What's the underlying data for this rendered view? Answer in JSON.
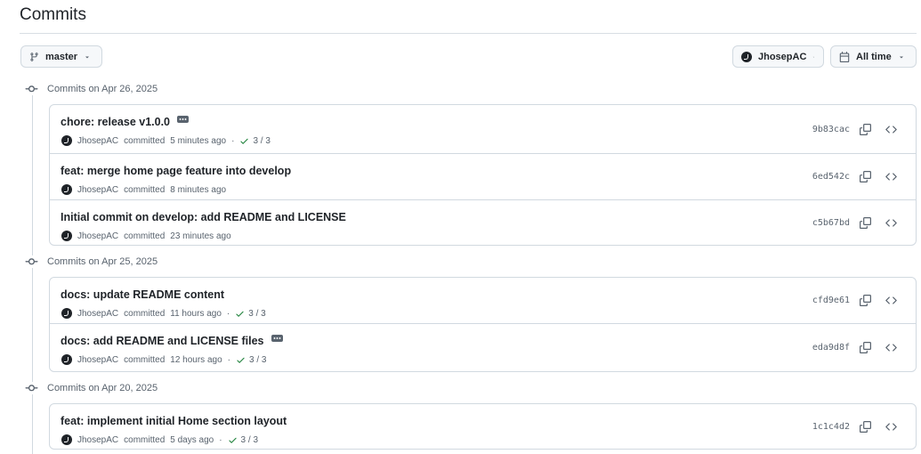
{
  "page": {
    "title": "Commits"
  },
  "toolbar": {
    "branch_label": "master",
    "user_label": "JhosepAC",
    "time_label": "All time"
  },
  "groups": [
    {
      "header": "Commits on Apr 26, 2025",
      "commits": [
        {
          "title": "chore: release v1.0.0",
          "has_ellipsis": true,
          "author": "JhosepAC",
          "action": "committed",
          "time": "5 minutes ago",
          "checks": "3 / 3",
          "sha": "9b83cac"
        },
        {
          "title": "feat: merge home page feature into develop",
          "has_ellipsis": false,
          "author": "JhosepAC",
          "action": "committed",
          "time": "8 minutes ago",
          "checks": "",
          "sha": "6ed542c"
        },
        {
          "title": "Initial commit on develop: add README and LICENSE",
          "has_ellipsis": false,
          "author": "JhosepAC",
          "action": "committed",
          "time": "23 minutes ago",
          "checks": "",
          "sha": "c5b67bd"
        }
      ]
    },
    {
      "header": "Commits on Apr 25, 2025",
      "commits": [
        {
          "title": "docs: update README content",
          "has_ellipsis": false,
          "author": "JhosepAC",
          "action": "committed",
          "time": "11 hours ago",
          "checks": "3 / 3",
          "sha": "cfd9e61"
        },
        {
          "title": "docs: add README and LICENSE files",
          "has_ellipsis": true,
          "author": "JhosepAC",
          "action": "committed",
          "time": "12 hours ago",
          "checks": "3 / 3",
          "sha": "eda9d8f"
        }
      ]
    },
    {
      "header": "Commits on Apr 20, 2025",
      "commits": [
        {
          "title": "feat: implement initial Home section layout",
          "has_ellipsis": false,
          "author": "JhosepAC",
          "action": "committed",
          "time": "5 days ago",
          "checks": "3 / 3",
          "sha": "1c1c4d2"
        }
      ]
    }
  ],
  "icons": {
    "branch": "git-branch-icon",
    "caret": "triangle-down-icon",
    "calendar": "calendar-icon",
    "commit": "git-commit-icon",
    "copy": "copy-icon",
    "browse": "code-icon",
    "check": "check-icon",
    "ellipsis": "kebab-horizontal-icon"
  },
  "colors": {
    "check_green": "#1a7f37",
    "border": "#d1d9e0",
    "muted_text": "#59636e"
  }
}
